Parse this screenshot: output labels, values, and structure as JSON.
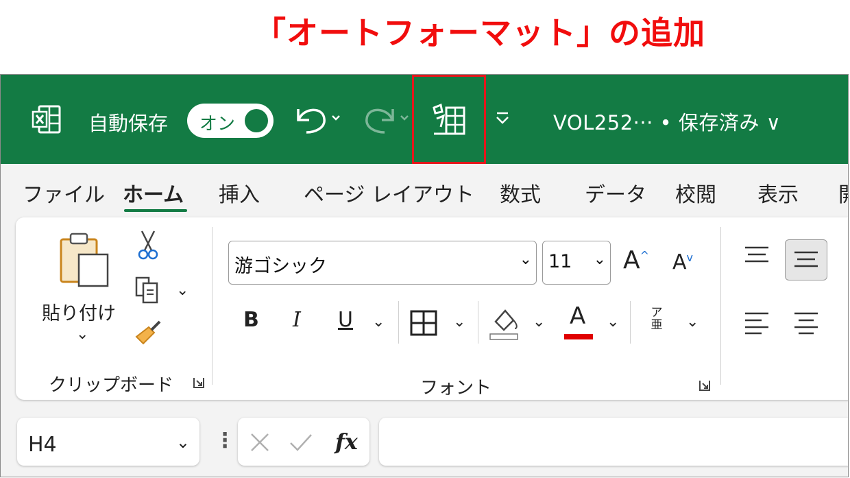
{
  "caption": "「オートフォーマット」の追加",
  "titlebar": {
    "autosave_label": "自動保存",
    "autosave_state": "オン",
    "document_title": "VOL252··· • 保存済み ∨"
  },
  "tabs": [
    "ファイル",
    "ホーム",
    "挿入",
    "ページ レイアウト",
    "数式",
    "データ",
    "校閲",
    "表示",
    "開"
  ],
  "ribbon": {
    "clipboard": {
      "paste_label": "貼り付け",
      "group_label": "クリップボード"
    },
    "font": {
      "font_name": "游ゴシック",
      "font_size": "11",
      "bold": "B",
      "italic": "I",
      "underline": "U",
      "ruby": "ア亜",
      "group_label": "フォント"
    }
  },
  "formula_bar": {
    "name_box": "H4",
    "fx": "fx",
    "formula": ""
  },
  "colors": {
    "titlebar": "#137b44",
    "highlight": "#e5161b",
    "caption": "#f10d0d",
    "font_color_bar": "#e00000"
  },
  "icons": [
    "excel-logo-icon",
    "undo-icon",
    "redo-icon",
    "autoformat-icon",
    "customize-qat-icon",
    "paste-icon",
    "cut-icon",
    "copy-icon",
    "format-painter-icon",
    "grow-font-icon",
    "shrink-font-icon",
    "borders-icon",
    "fill-color-icon",
    "font-color-icon",
    "align-top-icon",
    "align-middle-icon",
    "align-left-icon",
    "align-center-icon",
    "cancel-icon",
    "enter-icon"
  ]
}
